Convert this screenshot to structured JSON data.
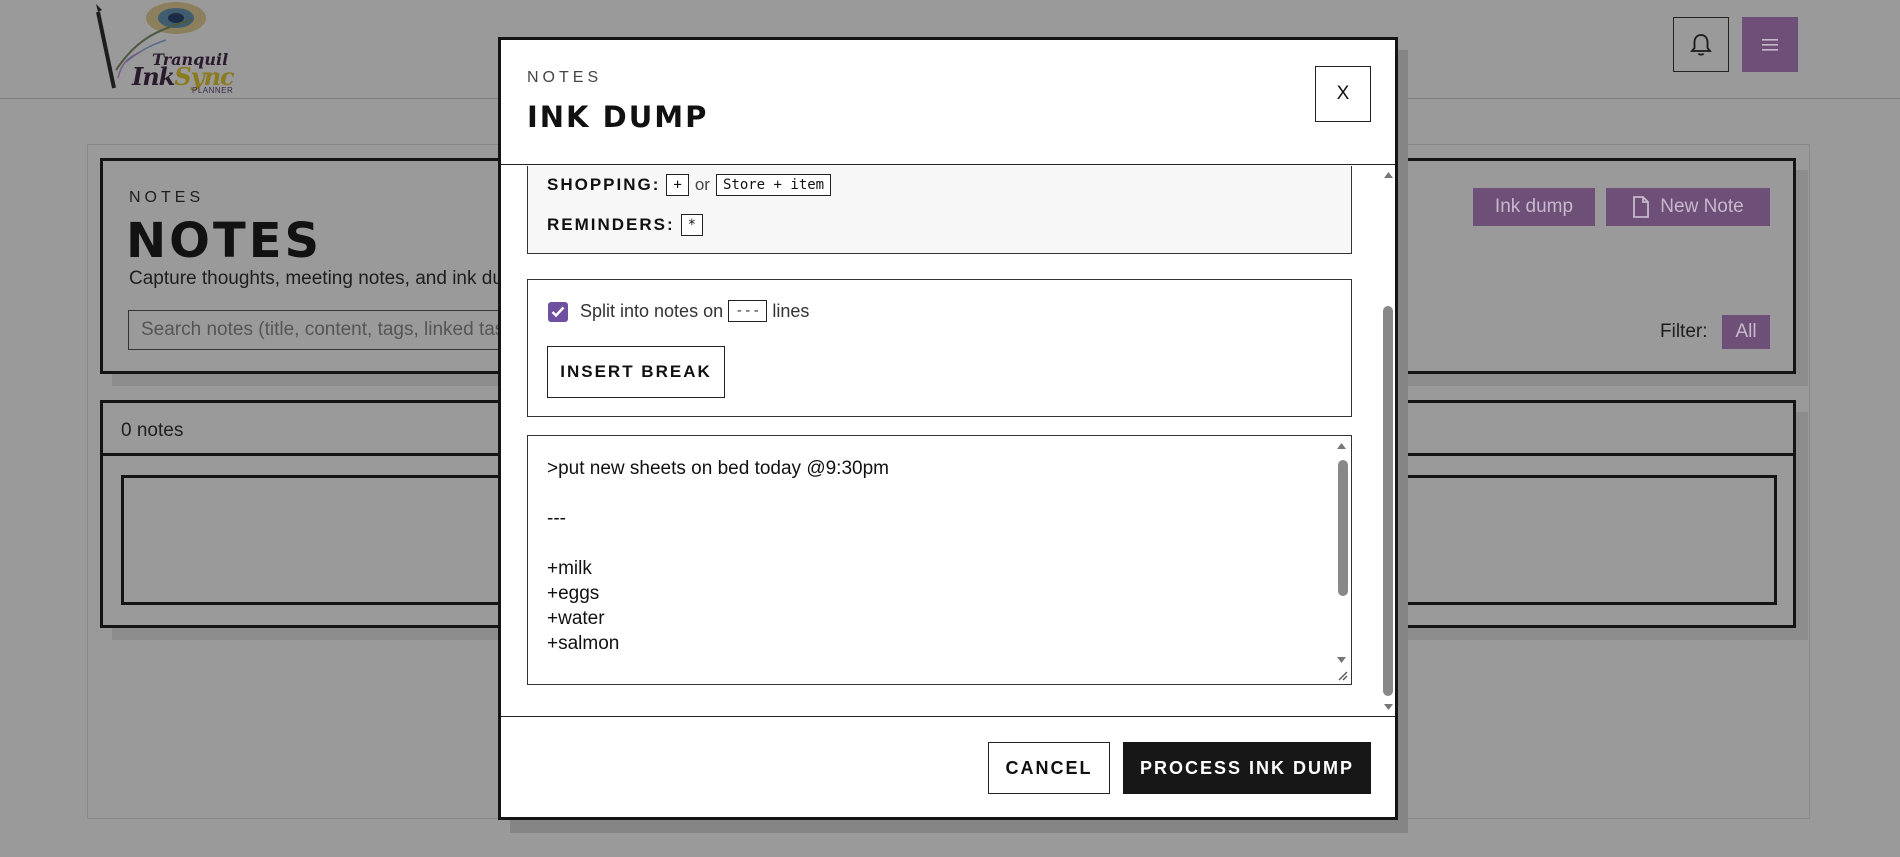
{
  "brand": {
    "logo_line1": "Tranquil",
    "logo_ink": "Ink",
    "logo_sync": "Sync",
    "logo_line3": "PLANNER"
  },
  "topbar": {
    "bell_icon": "bell-icon",
    "menu_icon": "hamburger-menu-icon",
    "accent_color": "#6e4f78"
  },
  "page": {
    "eyebrow": "NOTES",
    "title": "NOTES",
    "subtitle": "Capture thoughts, meeting notes, and ink du",
    "search_placeholder": "Search notes (title, content, tags, linked task",
    "ink_dump_button": "Ink dump",
    "new_note_button": "New Note",
    "filter_label": "Filter:",
    "filter_value": "All",
    "notes_count": "0 notes"
  },
  "modal": {
    "eyebrow": "NOTES",
    "title": "INK DUMP",
    "close_label": "X",
    "legend": {
      "shopping_label": "SHOPPING:",
      "shopping_key": "+",
      "or_text": "or",
      "shopping_alt": "Store + item",
      "reminders_label": "REMINDERS:",
      "reminders_key": "*"
    },
    "split": {
      "checked": true,
      "label_before": "Split into notes on",
      "separator": "---",
      "label_after": "lines",
      "insert_break": "INSERT BREAK"
    },
    "textarea_lines": [
      ">put new sheets on bed today @9:30pm",
      "",
      "---",
      "",
      "+milk",
      "+eggs",
      "+water",
      "+salmon"
    ],
    "cancel": "CANCEL",
    "process": "PROCESS INK DUMP"
  }
}
